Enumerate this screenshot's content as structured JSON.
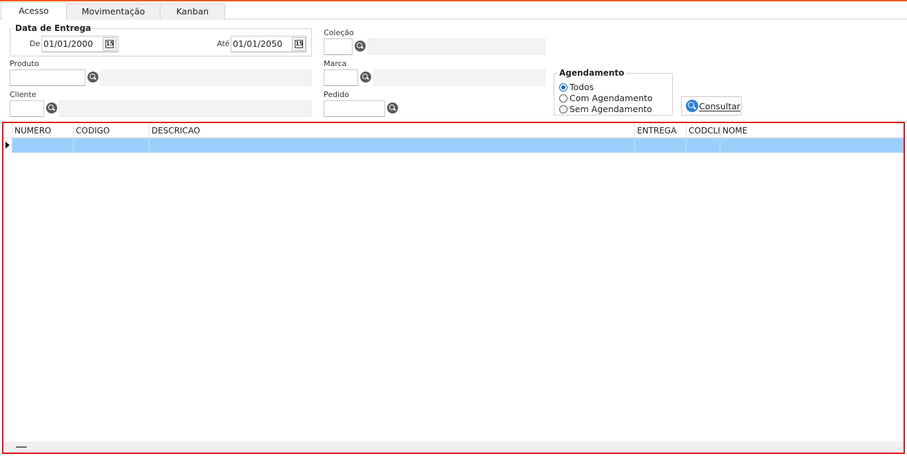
{
  "tabs": [
    {
      "label": "Acesso",
      "active": true
    },
    {
      "label": "Movimentação",
      "active": false
    },
    {
      "label": "Kanban",
      "active": false
    }
  ],
  "filters": {
    "data_entrega": {
      "title": "Data de Entrega",
      "de_label": "De",
      "de_value": "01/01/2000",
      "ate_label": "Até",
      "ate_value": "01/01/2050",
      "calendar_glyph": "15"
    },
    "produto": {
      "label": "Produto",
      "value": "",
      "description": ""
    },
    "cliente": {
      "label": "Cliente",
      "value": "",
      "description": ""
    },
    "colecao": {
      "label": "Coleção",
      "value": "",
      "description": ""
    },
    "marca": {
      "label": "Marca",
      "value": "",
      "description": ""
    },
    "pedido": {
      "label": "Pedido",
      "value": ""
    },
    "agendamento": {
      "title": "Agendamento",
      "options": [
        "Todos",
        "Com Agendamento",
        "Sem Agendamento"
      ],
      "selected": "Todos"
    },
    "consultar_label": "Consultar"
  },
  "grid": {
    "columns": [
      "NUMERO",
      "CODIGO",
      "DESCRICAO",
      "ENTREGA",
      "CODCLI",
      "NOME"
    ],
    "rows": [
      [
        "",
        "",
        "",
        "",
        "",
        ""
      ]
    ]
  },
  "colors": {
    "accent_top": "#f05a1a",
    "selected_row": "#9bd0fb",
    "grid_border": "#e01010"
  }
}
